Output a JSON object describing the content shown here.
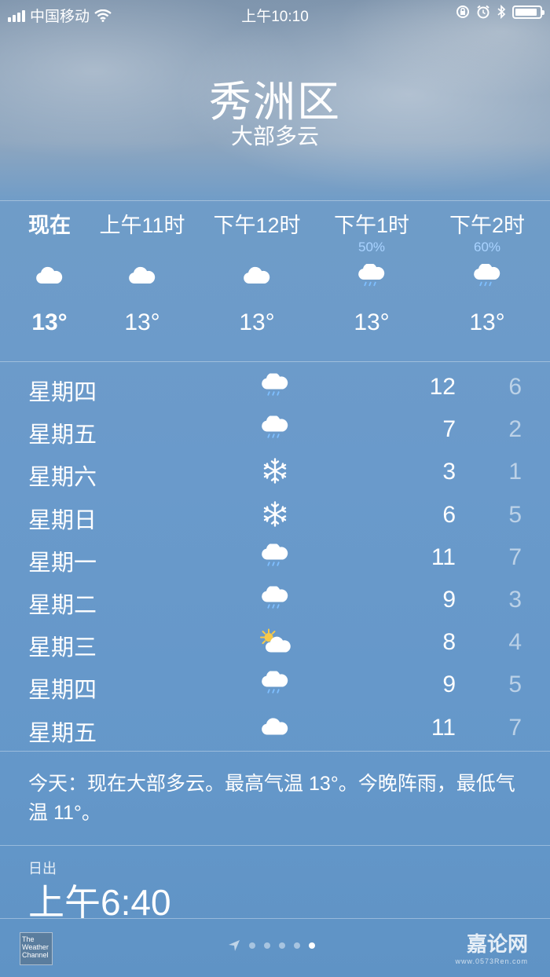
{
  "status_bar": {
    "carrier": "中国移动",
    "time": "上午10:10",
    "battery_level": 0.9
  },
  "location": {
    "city": "秀洲区",
    "condition": "大部多云"
  },
  "hourly": [
    {
      "label": "现在",
      "precip": "",
      "icon": "cloud-icon",
      "temp": "13°"
    },
    {
      "label": "上午11时",
      "precip": "",
      "icon": "cloud-icon",
      "temp": "13°"
    },
    {
      "label": "下午12时",
      "precip": "",
      "icon": "cloud-icon",
      "temp": "13°"
    },
    {
      "label": "下午1时",
      "precip": "50%",
      "icon": "rain-icon",
      "temp": "13°"
    },
    {
      "label": "下午2时",
      "precip": "60%",
      "icon": "rain-icon",
      "temp": "13°"
    }
  ],
  "daily": [
    {
      "day": "星期四",
      "icon": "rain-icon",
      "high": "12",
      "low": "6"
    },
    {
      "day": "星期五",
      "icon": "rain-icon",
      "high": "7",
      "low": "2"
    },
    {
      "day": "星期六",
      "icon": "snow-icon",
      "high": "3",
      "low": "1"
    },
    {
      "day": "星期日",
      "icon": "snow-icon",
      "high": "6",
      "low": "5"
    },
    {
      "day": "星期一",
      "icon": "rain-icon",
      "high": "11",
      "low": "7"
    },
    {
      "day": "星期二",
      "icon": "rain-icon",
      "high": "9",
      "low": "3"
    },
    {
      "day": "星期三",
      "icon": "partly-sunny-icon",
      "high": "8",
      "low": "4"
    },
    {
      "day": "星期四",
      "icon": "rain-icon",
      "high": "9",
      "low": "5"
    },
    {
      "day": "星期五",
      "icon": "cloud-icon",
      "high": "11",
      "low": "7"
    }
  ],
  "summary": "今天：现在大部多云。最高气温 13°。今晚阵雨，最低气温 11°。",
  "sunrise": {
    "label": "日出",
    "value": "上午6:40"
  },
  "footer": {
    "logo_text": "The Weather Channel",
    "page_count": 5,
    "active_page": 4,
    "watermark": "嘉论网",
    "watermark_sub": "www.0573Ren.com"
  }
}
